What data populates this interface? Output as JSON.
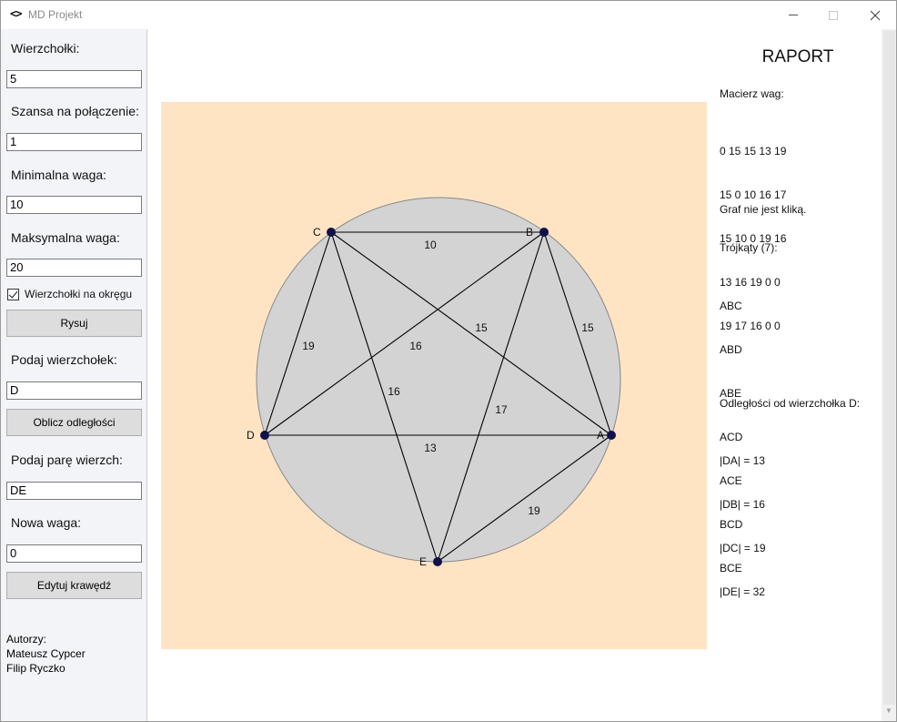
{
  "window": {
    "title": "MD Projekt",
    "icon": "code-brackets-icon",
    "icon_glyph": "<>"
  },
  "left_panel": {
    "vertices_label": "Wierzchołki:",
    "vertices_value": "5",
    "connection_label": "Szansa na połączenie:",
    "connection_value": "1",
    "min_weight_label": "Minimalna waga:",
    "min_weight_value": "10",
    "max_weight_label": "Maksymalna waga:",
    "max_weight_value": "20",
    "circle_checkbox_label": "Wierzchołki na okręgu",
    "circle_checkbox_checked": true,
    "draw_button": "Rysuj",
    "vertex_prompt_label": "Podaj wierzchołek:",
    "vertex_prompt_value": "D",
    "compute_button": "Oblicz odległości",
    "pair_label": "Podaj parę wierzch:",
    "pair_value": "DE",
    "new_weight_label": "Nowa waga:",
    "new_weight_value": "0",
    "edit_button": "Edytuj krawędź",
    "authors_heading": "Autorzy:",
    "authors": [
      "Mateusz Cypcer",
      "Filip Ryczko"
    ]
  },
  "graph": {
    "colors": {
      "background": "#ffe4c4",
      "circle_fill": "#d3d3d3",
      "circle_stroke": "#888888",
      "edge": "#000000",
      "vertex": "#10104a"
    },
    "vertices": [
      {
        "id": "A"
      },
      {
        "id": "B"
      },
      {
        "id": "C"
      },
      {
        "id": "D"
      },
      {
        "id": "E"
      }
    ],
    "edges": [
      {
        "from": "C",
        "to": "B",
        "weight": "10"
      },
      {
        "from": "C",
        "to": "A",
        "weight": "15"
      },
      {
        "from": "B",
        "to": "A",
        "weight": "15"
      },
      {
        "from": "C",
        "to": "D",
        "weight": "19"
      },
      {
        "from": "B",
        "to": "D",
        "weight": "16"
      },
      {
        "from": "C",
        "to": "E",
        "weight": "16"
      },
      {
        "from": "B",
        "to": "E",
        "weight": "17"
      },
      {
        "from": "D",
        "to": "A",
        "weight": "13"
      },
      {
        "from": "E",
        "to": "A",
        "weight": "19"
      }
    ]
  },
  "report": {
    "title": "RAPORT",
    "matrix_heading": "Macierz wag:",
    "matrix_rows": [
      "0 15 15 13 19",
      "15 0 10 16 17",
      "15 10 0 19 16",
      "13 16 19 0 0",
      "19 17 16 0 0"
    ],
    "clique_status": "Graf nie jest kliką.",
    "triangles_heading": "Trójkąty (7):",
    "triangles": [
      "ABC",
      "ABD",
      "ABE",
      "ACD",
      "ACE",
      "BCD",
      "BCE"
    ],
    "distances_heading": "Odległości od wierzchołka D:",
    "distances": [
      "|DA| = 13",
      "|DB| = 16",
      "|DC| = 19",
      "|DE| = 32"
    ]
  }
}
